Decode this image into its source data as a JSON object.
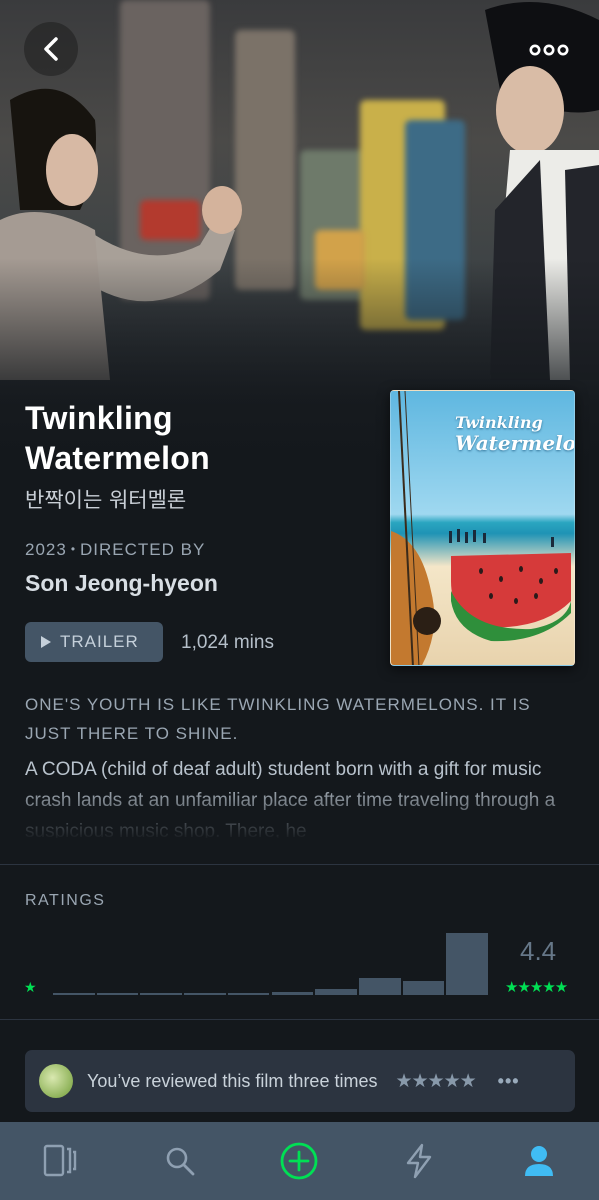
{
  "film": {
    "title": "Twinkling Watermelon",
    "original_title": "반짝이는 워터멜론",
    "year": "2023",
    "directed_by_label": "DIRECTED BY",
    "director": "Son Jeong-hyeon",
    "runtime": "1,024 mins",
    "tagline": "ONE'S YOUTH IS LIKE TWINKLING WATERMELONS. IT IS JUST THERE TO SHINE.",
    "synopsis": "A CODA (child of deaf adult) student born with a gift for music crash lands at an unfamiliar place after time traveling through a suspicious music shop. There, he"
  },
  "poster": {
    "title_line1": "Twinkling",
    "title_line2": "Watermelon"
  },
  "trailer": {
    "label": "TRAILER",
    "icon": "play-icon"
  },
  "header": {
    "back_icon": "chevron-left-icon",
    "more_icon": "more-horizontal-icon"
  },
  "ratings": {
    "label": "RATINGS",
    "average": "4.4",
    "min_star": "★",
    "max_stars": "★★★★★",
    "histogram_fraction": [
      0.03,
      0.03,
      0.03,
      0.03,
      0.03,
      0.05,
      0.09,
      0.28,
      0.22,
      1.0
    ]
  },
  "review": {
    "text": "You’ve reviewed this film three times",
    "stars": "★★★★★",
    "more": "•••"
  },
  "tabbar": {
    "items": [
      "films-icon",
      "search-icon",
      "add-icon",
      "activity-icon",
      "profile-icon"
    ]
  },
  "colors": {
    "background": "#14181c",
    "accent_green": "#00e054",
    "bar": "#445566",
    "active_tab": "#40bcf4"
  }
}
